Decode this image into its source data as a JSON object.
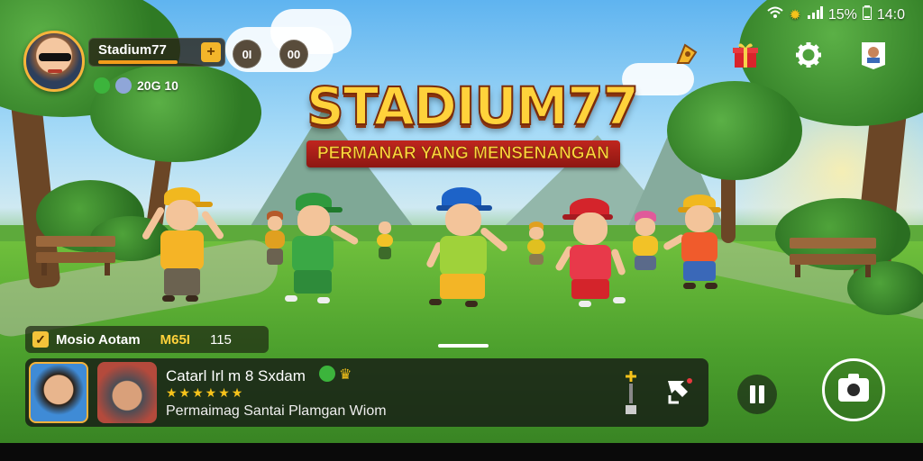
{
  "status_bar": {
    "battery": "15%",
    "time": "14:0"
  },
  "player": {
    "name": "Stadium77",
    "plus_label": "+",
    "badge_1": "0I",
    "badge_2": "00",
    "sub_value": "20G 10"
  },
  "game": {
    "title": "STADIUM77",
    "subtitle": "PERMANAR YANG MENSENANGAN"
  },
  "top_icons": [
    "rocket-icon",
    "gift-icon",
    "gear-icon",
    "profile-card-icon"
  ],
  "quest": {
    "label": "Mosio Aotam",
    "value_1": "M65I",
    "value_2": "115"
  },
  "chat": {
    "title": "Catarl Irl m 8 Sxdam",
    "rating_stars": "★★★★★★",
    "subtitle": "Permaimag Santai Plamgan Wiom"
  },
  "colors": {
    "title_yellow": "#ffd23b",
    "ribbon_red": "#c0261e",
    "accent_orange": "#f3b52a",
    "grass_green": "#4ca02d"
  }
}
